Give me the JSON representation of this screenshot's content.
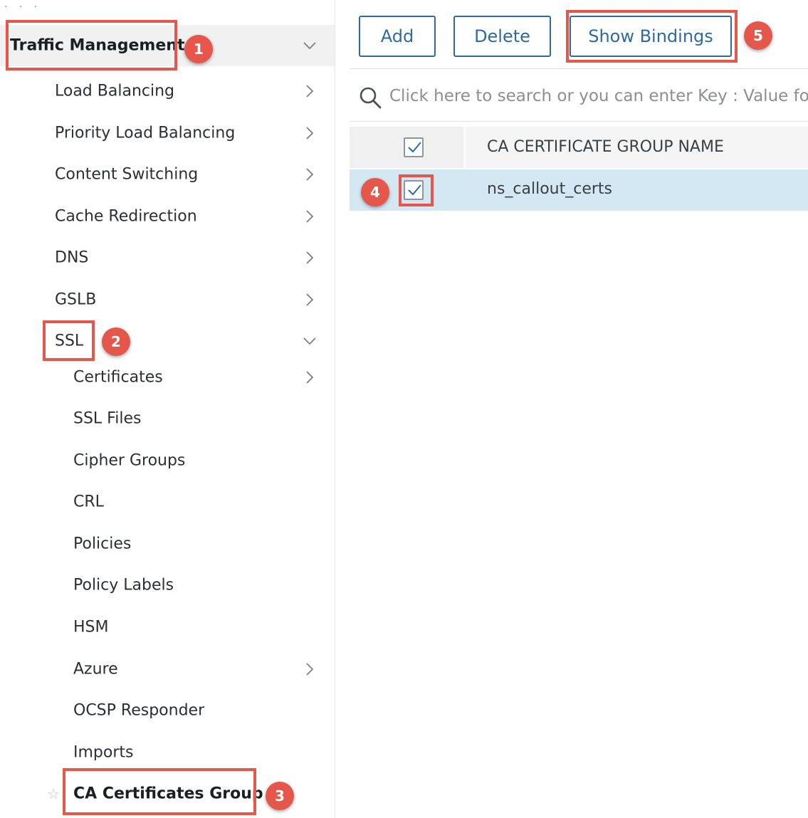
{
  "sidebar": {
    "section_title": "Traffic Management",
    "items": [
      {
        "label": "Load Balancing"
      },
      {
        "label": "Priority Load Balancing"
      },
      {
        "label": "Content Switching"
      },
      {
        "label": "Cache Redirection"
      },
      {
        "label": "DNS"
      },
      {
        "label": "GSLB"
      },
      {
        "label": "SSL"
      }
    ],
    "ssl_items": [
      {
        "label": "Certificates"
      },
      {
        "label": "SSL Files"
      },
      {
        "label": "Cipher Groups"
      },
      {
        "label": "CRL"
      },
      {
        "label": "Policies"
      },
      {
        "label": "Policy Labels"
      },
      {
        "label": "HSM"
      },
      {
        "label": "Azure"
      },
      {
        "label": "OCSP Responder"
      },
      {
        "label": "Imports"
      },
      {
        "label": "CA Certificates Group"
      }
    ]
  },
  "toolbar": {
    "add_label": "Add",
    "delete_label": "Delete",
    "show_bindings_label": "Show Bindings"
  },
  "search": {
    "placeholder": "Click here to search or you can enter Key : Value format"
  },
  "table": {
    "columns": [
      "CA CERTIFICATE GROUP NAME"
    ],
    "header_checked": true,
    "rows": [
      {
        "name": "ns_callout_certs",
        "checked": true
      }
    ]
  },
  "annotations": {
    "step1": "1",
    "step2": "2",
    "step3": "3",
    "step4": "4",
    "step5": "5"
  },
  "colors": {
    "highlight": "#e4574a",
    "button": "#2d6aa3",
    "selected_row": "#d4e8f4"
  }
}
